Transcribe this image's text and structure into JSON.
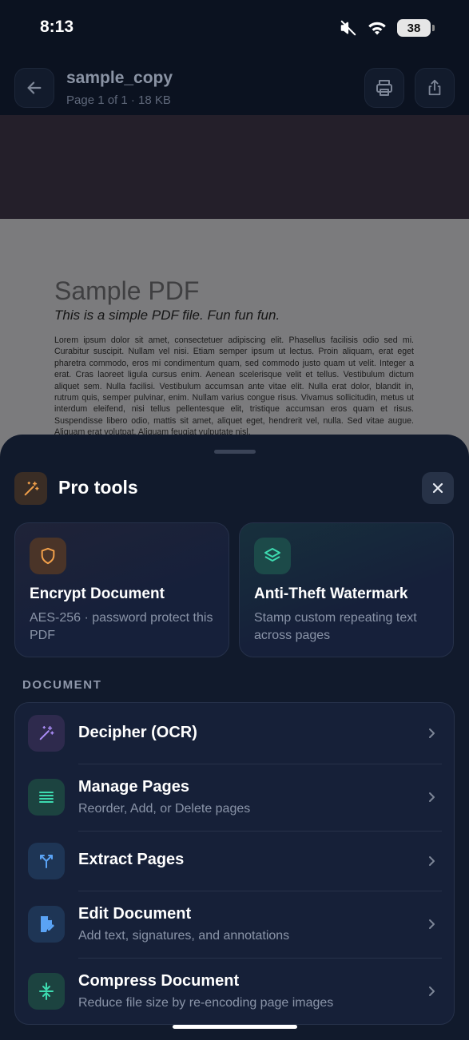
{
  "status_bar": {
    "time": "8:13",
    "battery": "38"
  },
  "header": {
    "title": "sample_copy",
    "subtitle": "Page 1 of 1 · 18 KB",
    "icons": {
      "back": "arrow-left-icon",
      "print": "printer-icon",
      "share": "share-icon"
    }
  },
  "pdf": {
    "heading": "Sample PDF",
    "subheading": "This is a simple PDF file. Fun fun fun.",
    "body": "Lorem ipsum dolor sit amet, consectetuer adipiscing elit. Phasellus facilisis odio sed mi. Curabitur suscipit. Nullam vel nisi. Etiam semper ipsum ut lectus. Proin aliquam, erat eget pharetra commodo, eros mi condimentum quam, sed commodo justo quam ut velit. Integer a erat. Cras laoreet ligula cursus enim. Aenean scelerisque velit et tellus. Vestibulum dictum aliquet sem. Nulla facilisi. Vestibulum accumsan ante vitae elit. Nulla erat dolor, blandit in, rutrum quis, semper pulvinar, enim. Nullam varius congue risus. Vivamus sollicitudin, metus ut interdum eleifend, nisi tellus pellentesque elit, tristique accumsan eros quam et risus. Suspendisse libero odio, mattis sit amet, aliquet eget, hendrerit vel, nulla. Sed vitae augue. Aliquam erat volutpat. Aliquam feugiat vulputate nisl."
  },
  "sheet": {
    "title": "Pro tools",
    "icon": "magic-wand-icon",
    "close_icon": "close-icon",
    "pro_cards": [
      {
        "title": "Encrypt Document",
        "description": "AES-256 · password protect this PDF",
        "icon": "shield-icon",
        "color": "#f2a04a"
      },
      {
        "title": "Anti-Theft Watermark",
        "description": "Stamp custom repeating text across pages",
        "icon": "layers-icon",
        "color": "#3ddbb0"
      }
    ],
    "section_label": "DOCUMENT",
    "tools": [
      {
        "title": "Decipher (OCR)",
        "subtitle": "",
        "icon": "magic-wand-icon",
        "color": "#a98bf5"
      },
      {
        "title": "Manage Pages",
        "subtitle": "Reorder, Add, or Delete pages",
        "icon": "list-icon",
        "color": "#3ddbb0"
      },
      {
        "title": "Extract Pages",
        "subtitle": "",
        "icon": "split-arrows-icon",
        "color": "#5aa3f5"
      },
      {
        "title": "Edit Document",
        "subtitle": "Add text, signatures, and annotations",
        "icon": "edit-document-icon",
        "color": "#5aa3f5"
      },
      {
        "title": "Compress Document",
        "subtitle": "Reduce file size by re-encoding page images",
        "icon": "compress-icon",
        "color": "#3ddbb0"
      }
    ]
  }
}
